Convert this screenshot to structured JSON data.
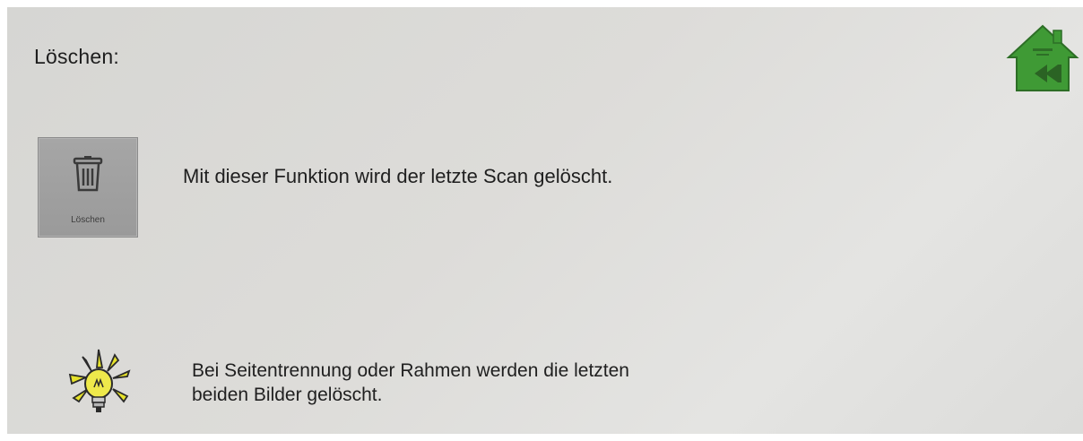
{
  "page": {
    "title": "Löschen:",
    "home_icon_text": "Back"
  },
  "delete_button": {
    "label": "Löschen",
    "icon": "trash-icon"
  },
  "description": "Mit dieser Funktion wird der letzte Scan gelöscht.",
  "tip": {
    "icon": "lightbulb-icon",
    "line1": "Bei Seitentrennung oder Rahmen werden die letzten",
    "line2": "beiden Bilder gelöscht."
  },
  "colors": {
    "home_green": "#3f9a35",
    "button_gray": "#a0a0a0",
    "bulb_yellow": "#e6e22a"
  }
}
